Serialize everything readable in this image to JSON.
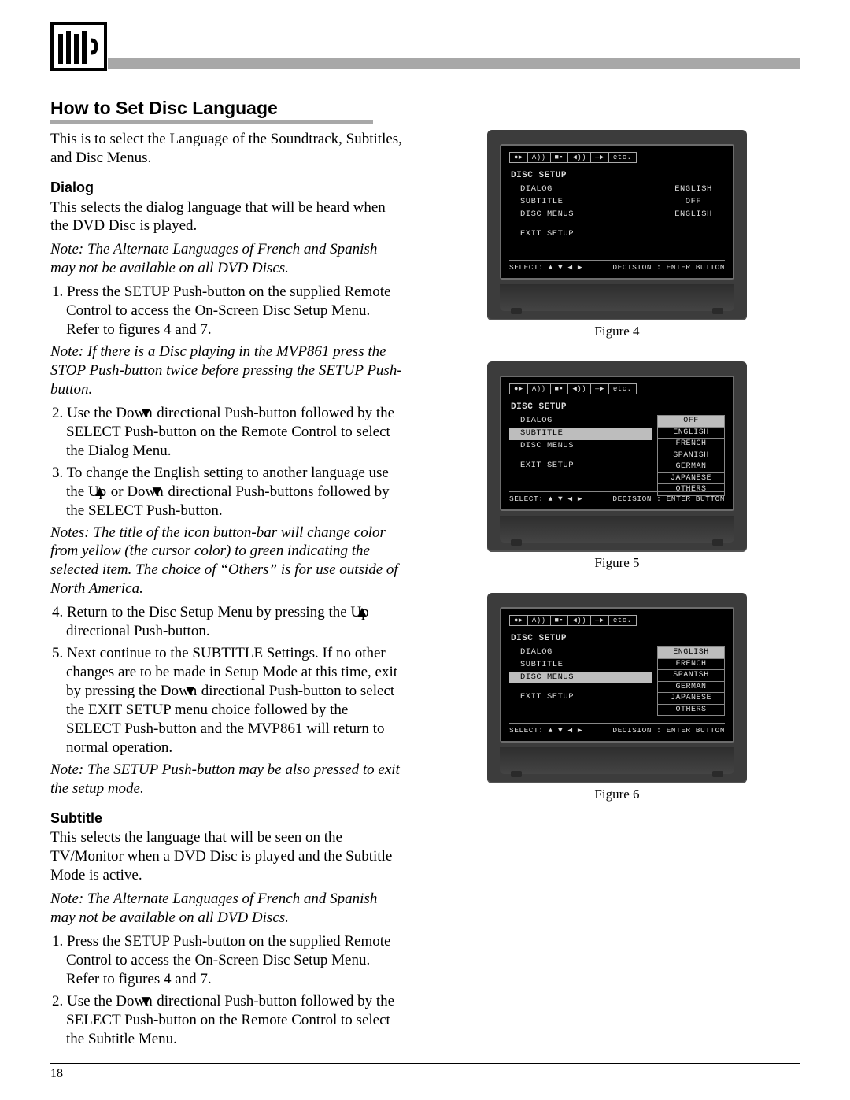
{
  "pageNumber": "18",
  "title": "How to Set Disc Language",
  "intro": "This is to select the Language of the Soundtrack, Subtitles, and Disc Menus.",
  "dialog": {
    "heading": "Dialog",
    "lead": "This selects the dialog language that will be heard when the DVD Disc is played.",
    "note1": "Note: The Alternate Languages of French and Spanish may not be available on all DVD Discs.",
    "step1": "1. Press the SETUP Push-button on the supplied Remote Control to access the On-Screen Disc Setup Menu. Refer to figures 4 and 7.",
    "note2": "Note: If there is a Disc playing in the MVP861 press the STOP Push-button twice before pressing the SETUP Push-button.",
    "step2a": "2. Use the Down",
    "step2b": " directional Push-button followed by the SELECT Push-button on the Remote Control to select the Dialog Menu.",
    "step3a": "3. To change the English setting to another language use the Up",
    "step3b": " or Down",
    "step3c": " directional Push-buttons followed by the SELECT Push-button.",
    "note3": "Notes: The title of the icon button-bar will change color from yellow (the cursor color) to green indicating the selected item. The  choice of “Others” is for use outside of North America.",
    "step4a": "4. Return to the Disc Setup Menu by pressing the Up",
    "step4b": " directional Push-button.",
    "step5a": "5. Next continue to the SUBTITLE Settings. If no other changes are to be made in Setup Mode at this time, exit by pressing the Down",
    "step5b": " directional Push-button to select the EXIT SETUP menu choice followed by the SELECT Push-button and the MVP861 will return to normal operation.",
    "note4": "Note: The SETUP Push-button may be also pressed to exit the setup mode."
  },
  "subtitle": {
    "heading": "Subtitle",
    "lead": "This selects the language that will be seen on the TV/Monitor when a DVD Disc is played and the Subtitle Mode is active.",
    "note1": "Note: The Alternate Languages of French and Spanish may not be available on all DVD Discs.",
    "step1": "1. Press the SETUP Push-button on the supplied Remote Control to access the On-Screen Disc Setup Menu. Refer to figures 4 and 7.",
    "step2a": "2. Use the Down",
    "step2b": " directional Push-button followed by the SELECT Push-button on the Remote Control to select the Subtitle Menu."
  },
  "figures": {
    "f4": {
      "caption": "Figure 4",
      "screenTitle": "DISC SETUP",
      "rows": [
        {
          "label": "DIALOG",
          "val": "ENGLISH"
        },
        {
          "label": "SUBTITLE",
          "val": "OFF"
        },
        {
          "label": "DISC MENUS",
          "val": "ENGLISH"
        }
      ],
      "exit": "EXIT SETUP",
      "footerLeft": "SELECT: ▲ ▼ ◀ ▶",
      "footerRight": "DECISION : ENTER BUTTON",
      "crumbs": [
        "●▶",
        "A))",
        "■▪",
        "◀))",
        "—▶",
        "etc."
      ]
    },
    "f5": {
      "caption": "Figure 5",
      "screenTitle": "DISC SETUP",
      "items": [
        "DIALOG",
        "SUBTITLE",
        "DISC MENUS",
        "",
        "EXIT SETUP"
      ],
      "highlight": 1,
      "options": [
        "OFF",
        "ENGLISH",
        "FRENCH",
        "SPANISH",
        "GERMAN",
        "JAPANESE",
        "OTHERS"
      ],
      "optHighlight": 0,
      "footerLeft": "SELECT: ▲ ▼ ◀ ▶",
      "footerRight": "DECISION : ENTER BUTTON",
      "crumbs": [
        "●▶",
        "A))",
        "■▪",
        "◀))",
        "—▶",
        "etc."
      ]
    },
    "f6": {
      "caption": "Figure 6",
      "screenTitle": "DISC SETUP",
      "items": [
        "DIALOG",
        "SUBTITLE",
        "DISC MENUS",
        "",
        "EXIT SETUP"
      ],
      "highlight": 2,
      "options": [
        "ENGLISH",
        "FRENCH",
        "SPANISH",
        "GERMAN",
        "JAPANESE",
        "OTHERS"
      ],
      "optHighlight": 0,
      "footerLeft": "SELECT: ▲ ▼ ◀ ▶",
      "footerRight": "DECISION : ENTER BUTTON",
      "crumbs": [
        "●▶",
        "A))",
        "■▪",
        "◀))",
        "—▶",
        "etc."
      ]
    }
  }
}
